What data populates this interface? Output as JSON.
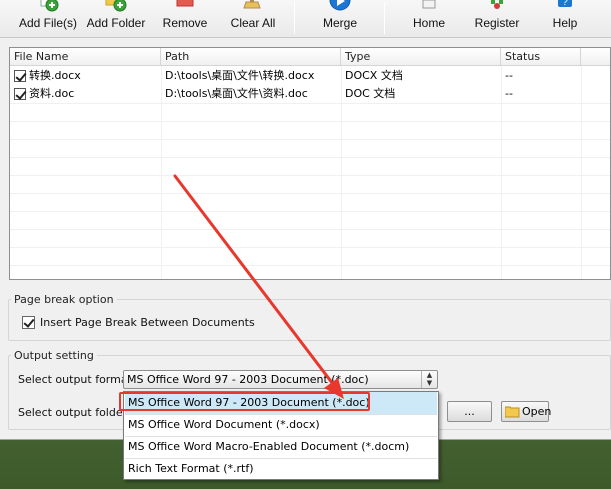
{
  "toolbar": {
    "buttons": [
      {
        "label": "Add File(s)",
        "icon": "add-file-icon"
      },
      {
        "label": "Add Folder",
        "icon": "add-folder-icon"
      },
      {
        "label": "Remove",
        "icon": "remove-icon"
      },
      {
        "label": "Clear All",
        "icon": "clear-all-icon"
      },
      {
        "label": "Merge",
        "icon": "merge-icon"
      },
      {
        "label": "Home",
        "icon": "home-icon"
      },
      {
        "label": "Register",
        "icon": "register-icon"
      },
      {
        "label": "Help",
        "icon": "help-icon"
      }
    ]
  },
  "file_list": {
    "columns": [
      "File Name",
      "Path",
      "Type",
      "Status"
    ],
    "rows": [
      {
        "name": "转换.docx",
        "path": "D:\\tools\\桌面\\文件\\转换.docx",
        "type": "DOCX 文档",
        "status": "--"
      },
      {
        "name": "资料.doc",
        "path": "D:\\tools\\桌面\\文件\\资料.doc",
        "type": "DOC 文档",
        "status": "--"
      }
    ]
  },
  "page_break": {
    "title": "Page break option",
    "checkbox_label": "Insert Page Break Between Documents"
  },
  "output": {
    "title": "Output setting",
    "format_label": "Select output format:",
    "format_value": "MS Office Word 97 - 2003 Document (*.doc)",
    "folder_label": "Select output folder:",
    "browse_label": "...",
    "open_label": "Open"
  },
  "dropdown": {
    "options": [
      "MS Office Word 97 - 2003 Document (*.doc)",
      "MS Office Word Document (*.docx)",
      "MS Office Word Macro-Enabled Document (*.docm)",
      "Rich Text Format (*.rtf)"
    ]
  },
  "colors": {
    "highlight": "#e8372c",
    "selected": "#cde8f7"
  }
}
